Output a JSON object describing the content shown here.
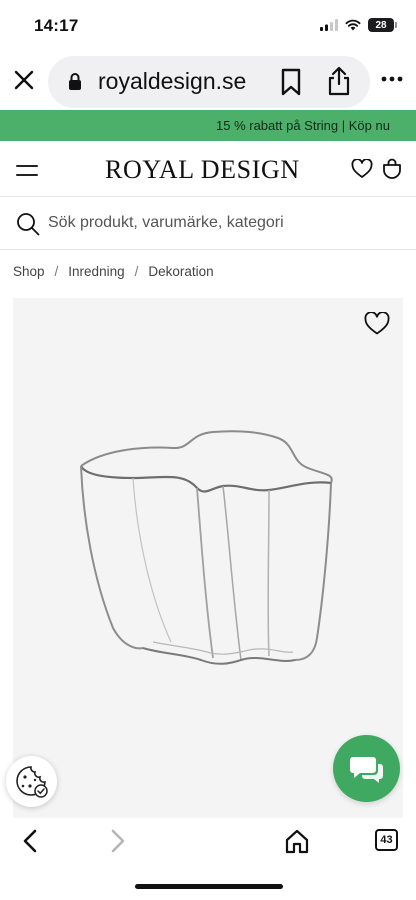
{
  "status_bar": {
    "time": "14:17",
    "battery": "28",
    "icons": [
      "signal-icon",
      "wifi-icon",
      "battery-icon"
    ]
  },
  "browser": {
    "url": "royaldesign.se",
    "tab_count": "43",
    "icons": [
      "close-icon",
      "lock-icon",
      "bookmark-icon",
      "share-icon",
      "more-icon",
      "back-icon",
      "forward-icon",
      "home-icon",
      "tabs-icon"
    ]
  },
  "promo": {
    "text": "15 % rabatt på String | Köp nu"
  },
  "header": {
    "logo": "ROYAL DESIGN",
    "icons": [
      "menu-icon",
      "heart-icon",
      "bag-icon"
    ]
  },
  "search": {
    "placeholder": "Sök produkt, varumärke, kategori"
  },
  "breadcrumb": {
    "items": [
      "Shop",
      "Inredning",
      "Dekoration"
    ],
    "separator": "/"
  },
  "product": {
    "image": "glass-vase-image"
  },
  "colors": {
    "promo_bg": "#4caf6a",
    "chat_bg": "#3fa962",
    "panel_bg": "#f4f4f4",
    "url_pill_bg": "#f0f0f2"
  }
}
